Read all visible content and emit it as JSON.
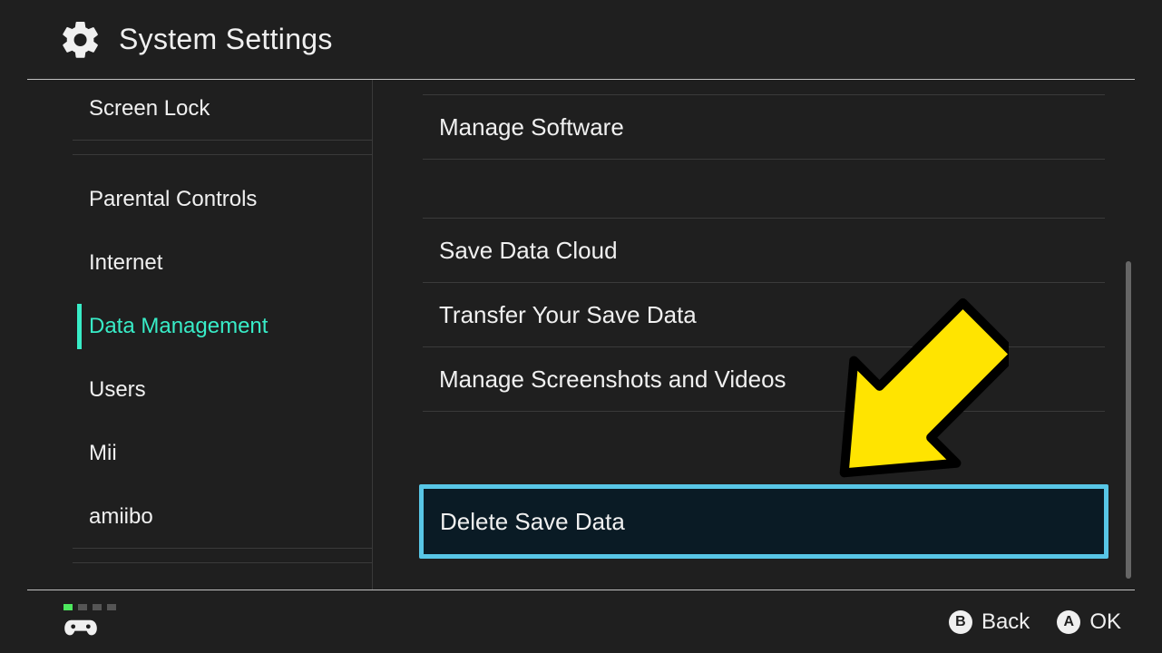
{
  "header": {
    "title": "System Settings"
  },
  "sidebar": {
    "items": [
      {
        "label": "Screen Lock"
      },
      {
        "label": "Parental Controls"
      },
      {
        "label": "Internet"
      },
      {
        "label": "Data Management",
        "active": true
      },
      {
        "label": "Users"
      },
      {
        "label": "Mii"
      },
      {
        "label": "amiibo"
      }
    ]
  },
  "main": {
    "rows": [
      {
        "label": "Manage Software"
      },
      {
        "label": "Save Data Cloud"
      },
      {
        "label": "Transfer Your Save Data"
      },
      {
        "label": "Manage Screenshots and Videos"
      },
      {
        "label": "Delete Save Data",
        "highlight": true
      }
    ]
  },
  "footer": {
    "buttons": [
      {
        "key": "B",
        "label": "Back"
      },
      {
        "key": "A",
        "label": "OK"
      }
    ]
  },
  "colors": {
    "accent": "#38ecc7",
    "highlight_border": "#58c6e6",
    "arrow": "#FFE400"
  }
}
